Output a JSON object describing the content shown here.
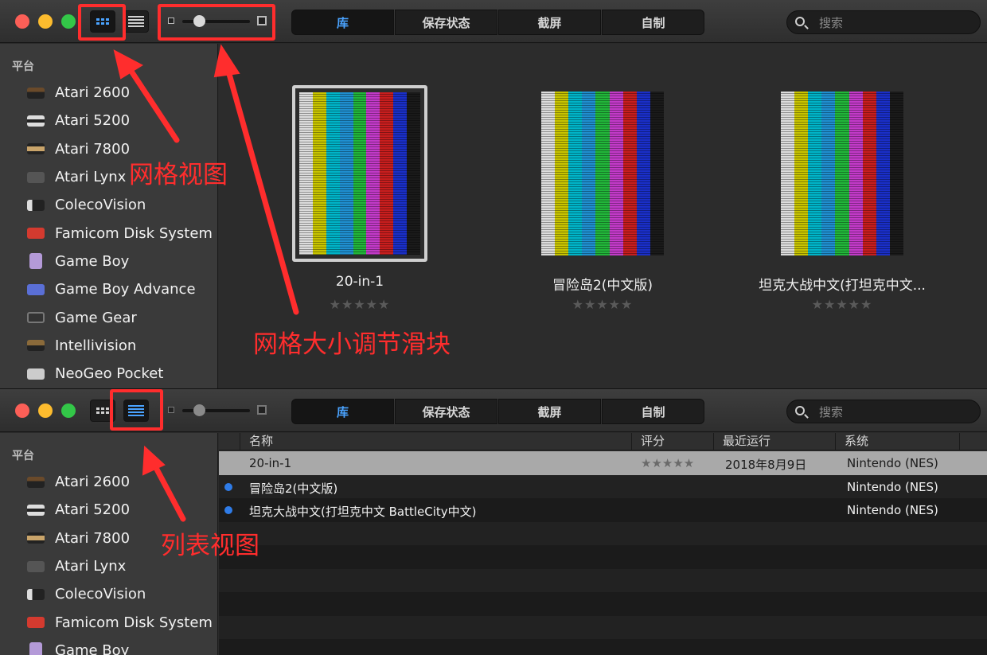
{
  "accent_color": "#4aa3ff",
  "annotation_color": "#ff2d2d",
  "tabs": [
    {
      "label": "库",
      "selected": true
    },
    {
      "label": "保存状态",
      "selected": false
    },
    {
      "label": "截屏",
      "selected": false
    },
    {
      "label": "自制",
      "selected": false
    }
  ],
  "search": {
    "placeholder": "搜索",
    "value": ""
  },
  "sidebar": {
    "heading": "平台",
    "items": [
      {
        "label": "Atari 2600",
        "icon": "atari-2600-console-icon"
      },
      {
        "label": "Atari 5200",
        "icon": "atari-5200-console-icon"
      },
      {
        "label": "Atari 7800",
        "icon": "atari-7800-console-icon"
      },
      {
        "label": "Atari Lynx",
        "icon": "atari-lynx-handheld-icon"
      },
      {
        "label": "ColecoVision",
        "icon": "colecovision-console-icon"
      },
      {
        "label": "Famicom Disk System",
        "icon": "famicom-disk-system-icon"
      },
      {
        "label": "Game Boy",
        "icon": "game-boy-handheld-icon"
      },
      {
        "label": "Game Boy Advance",
        "icon": "game-boy-advance-handheld-icon"
      },
      {
        "label": "Game Gear",
        "icon": "game-gear-handheld-icon"
      },
      {
        "label": "Intellivision",
        "icon": "intellivision-console-icon"
      },
      {
        "label": "NeoGeo Pocket",
        "icon": "neogeo-pocket-handheld-icon"
      }
    ]
  },
  "grid_view": {
    "games": [
      {
        "title": "20-in-1",
        "rating": "★★★★★",
        "rating_value": 0,
        "selected": true
      },
      {
        "title": "冒险岛2(中文版)",
        "rating": "★★★★★",
        "rating_value": 0,
        "selected": false
      },
      {
        "title": "坦克大战中文(打坦克中文...",
        "rating": "★★★★★",
        "rating_value": 0,
        "selected": false
      }
    ],
    "cover_bar_colors": [
      "#dcdcdc",
      "#c8c400",
      "#00b4c8",
      "#1f8fd0",
      "#22b63a",
      "#c23ac8",
      "#c81e1e",
      "#1a2fc8",
      "#1a1a1a"
    ],
    "slider_level": 0.2
  },
  "list_view": {
    "columns": [
      "名称",
      "评分",
      "最近运行",
      "系统"
    ],
    "rows": [
      {
        "name": "20-in-1",
        "rating": "★★★★★",
        "last_played": "2018年8月9日",
        "system": "Nintendo (NES)",
        "new": false,
        "selected": true
      },
      {
        "name": "冒险岛2(中文版)",
        "rating": "",
        "last_played": "",
        "system": "Nintendo (NES)",
        "new": true,
        "selected": false
      },
      {
        "name": "坦克大战中文(打坦克中文 BattleCity中文)",
        "rating": "",
        "last_played": "",
        "system": "Nintendo (NES)",
        "new": true,
        "selected": false
      }
    ]
  },
  "annotations": {
    "grid_view": "网格视图",
    "slider": "网格大小调节滑块",
    "list_view": "列表视图"
  }
}
